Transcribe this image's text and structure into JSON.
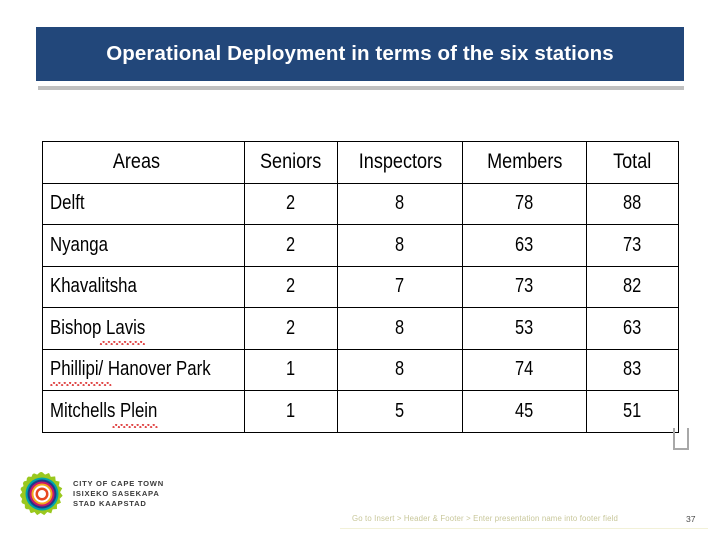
{
  "slide": {
    "title": "Operational Deployment in terms of the six stations",
    "title_bar_color": "#22477a",
    "rule_color": "#c0c0c0"
  },
  "table": {
    "columns": [
      "Areas",
      "Seniors",
      "Inspectors",
      "Members",
      "Total"
    ],
    "rows": [
      {
        "area": "Delft",
        "seniors": "2",
        "inspectors": "8",
        "members": "78",
        "total": "88",
        "misspelled": false
      },
      {
        "area": "Nyanga",
        "seniors": "2",
        "inspectors": "8",
        "members": "63",
        "total": "73",
        "misspelled": true
      },
      {
        "area": "Khavalitsha",
        "seniors": "2",
        "inspectors": "7",
        "members": "73",
        "total": "82",
        "misspelled": true
      },
      {
        "area": "Bishop Lavis",
        "seniors": "2",
        "inspectors": "8",
        "members": "53",
        "total": "63",
        "misspelled": true
      },
      {
        "area": "Phillipi/ Hanover Park",
        "seniors": "1",
        "inspectors": "8",
        "members": "74",
        "total": "83",
        "misspelled": true
      },
      {
        "area": "Mitchells Plein",
        "seniors": "1",
        "inspectors": "5",
        "members": "45",
        "total": "51",
        "misspelled": true
      }
    ]
  },
  "logo": {
    "line1": "CITY OF CAPE TOWN",
    "line2": "ISIXEKO SASEKAPA",
    "line3": "STAD KAAPSTAD"
  },
  "footer": {
    "note": "Go to Insert > Header & Footer > Enter presentation name into footer field",
    "page_number": "37"
  }
}
